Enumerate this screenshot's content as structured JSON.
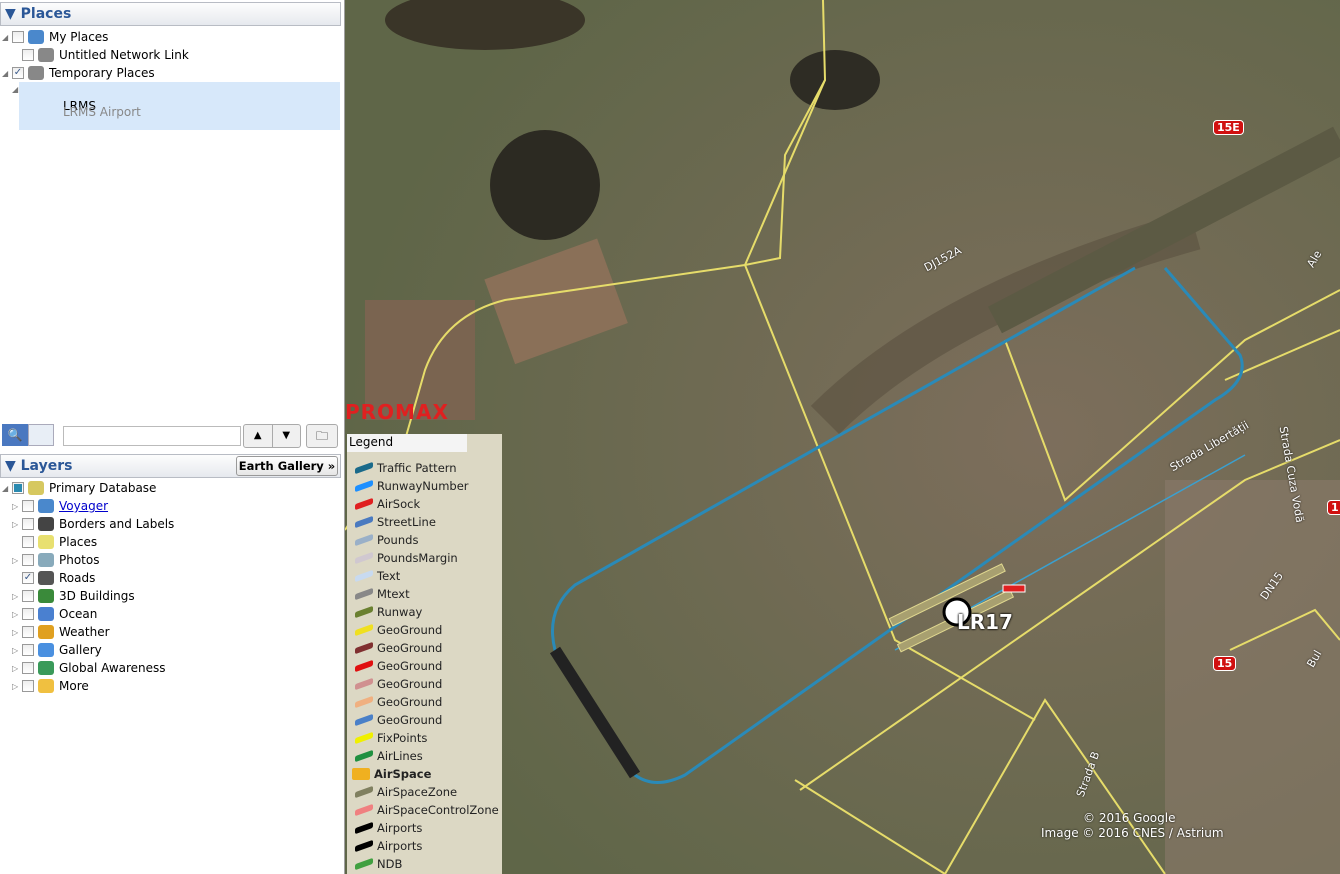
{
  "places": {
    "title": "Places",
    "items": [
      {
        "label": "My Places",
        "checked": false,
        "icon": "globe-icon"
      },
      {
        "label": "Untitled Network Link",
        "checked": false,
        "icon": "network-link-icon"
      },
      {
        "label": "Temporary Places",
        "checked": true,
        "icon": "folder-icon"
      },
      {
        "label": "LRMS",
        "checked": true,
        "icon": "globe-icon",
        "link": true
      },
      {
        "label": "LRMS",
        "sublabel": "LRMS Airport"
      }
    ]
  },
  "toolbar": {
    "search_value": "",
    "up": "▲",
    "down": "▼"
  },
  "layers": {
    "title": "Layers",
    "gallery_button": "Earth Gallery »",
    "items": [
      {
        "label": "Primary Database",
        "icon": "database-icon",
        "color": "#d6c860"
      },
      {
        "label": "Voyager",
        "icon": "globe-icon",
        "link": true,
        "color": "#4a88cc"
      },
      {
        "label": "Borders and Labels",
        "icon": "flag-icon",
        "color": "#444"
      },
      {
        "label": "Places",
        "icon": "places-icon",
        "color": "#e8e070"
      },
      {
        "label": "Photos",
        "icon": "photo-icon",
        "color": "#8ab"
      },
      {
        "label": "Roads",
        "icon": "road-icon",
        "checked": true,
        "color": "#555"
      },
      {
        "label": "3D Buildings",
        "icon": "buildings-icon",
        "color": "#3a8a3a"
      },
      {
        "label": "Ocean",
        "icon": "ocean-icon",
        "color": "#4a80d0"
      },
      {
        "label": "Weather",
        "icon": "sun-icon",
        "color": "#e0a020"
      },
      {
        "label": "Gallery",
        "icon": "star-icon",
        "color": "#4a90e0"
      },
      {
        "label": "Global Awareness",
        "icon": "earth-icon",
        "color": "#3a9a5a"
      },
      {
        "label": "More",
        "icon": "note-icon",
        "color": "#f0c040"
      }
    ]
  },
  "map": {
    "brand": "PROMAX",
    "legend_title": "Legend",
    "legend": [
      {
        "label": "Traffic Pattern",
        "color": "#1a6a8a"
      },
      {
        "label": "RunwayNumber",
        "color": "#1e90ff"
      },
      {
        "label": "AirSock",
        "color": "#e02020"
      },
      {
        "label": "StreetLine",
        "color": "#4a7ac0"
      },
      {
        "label": "Pounds",
        "color": "#9ab0c8"
      },
      {
        "label": "PoundsMargin",
        "color": "#d0c8d0"
      },
      {
        "label": "Text",
        "color": "#c8daf0"
      },
      {
        "label": "Mtext",
        "color": "#888"
      },
      {
        "label": "Runway",
        "color": "#6a8030"
      },
      {
        "label": "GeoGround",
        "color": "#f0e020"
      },
      {
        "label": "GeoGround",
        "color": "#803030"
      },
      {
        "label": "GeoGround",
        "color": "#e01010"
      },
      {
        "label": "GeoGround",
        "color": "#d09090"
      },
      {
        "label": "GeoGround",
        "color": "#f0b080"
      },
      {
        "label": "GeoGround",
        "color": "#4a80c8"
      },
      {
        "label": "FixPoints",
        "color": "#f0f000"
      },
      {
        "label": "AirLines",
        "color": "#209040"
      },
      {
        "label": "AirSpace",
        "color": "#f0b020",
        "folder": true
      },
      {
        "label": "AirSpaceZone",
        "color": "#808060"
      },
      {
        "label": "AirSpaceControlZone",
        "color": "#f08080"
      },
      {
        "label": "Airports",
        "color": "#000"
      },
      {
        "label": "Airports",
        "color": "#000"
      },
      {
        "label": "NDB",
        "color": "#40a040"
      }
    ],
    "labels": {
      "dj152a": "DJ152A",
      "r15e": "15E",
      "r15": "15",
      "r15b": "1",
      "dn15": "DN15",
      "libertatii": "Strada Libertății",
      "cuza": "Strada Cuza Vodă",
      "ale": "Ale",
      "bul": "Bul",
      "strb": "Strada B",
      "runway": "LR17"
    },
    "copyright1": "© 2016 Google",
    "copyright2": "Image © 2016 CNES / Astrium"
  }
}
